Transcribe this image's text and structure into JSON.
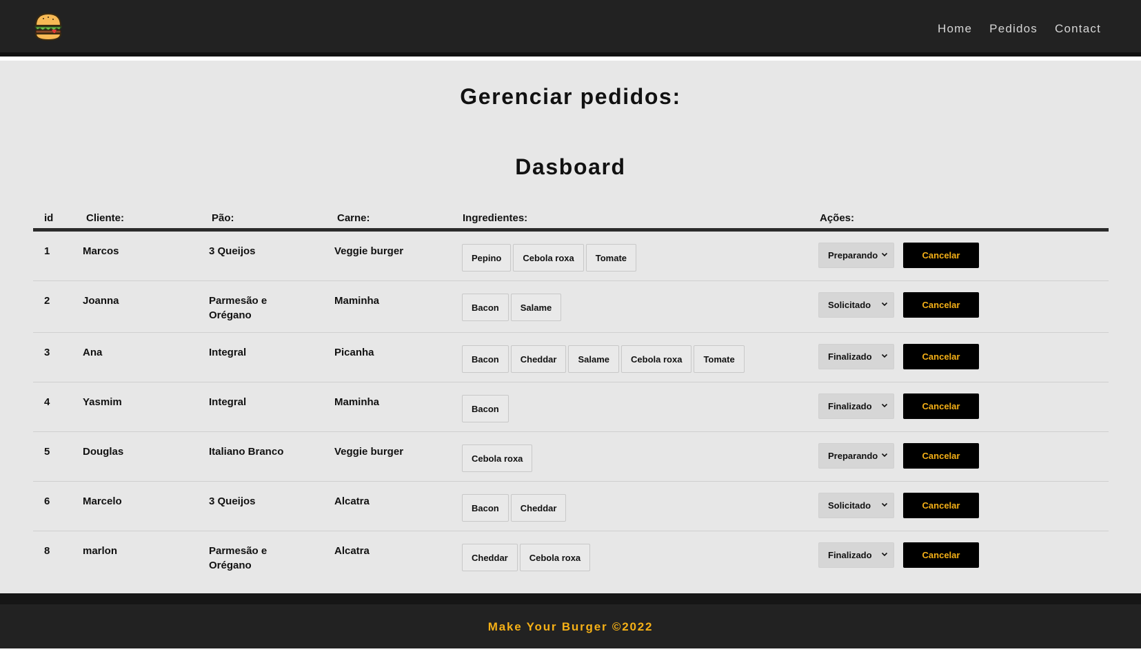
{
  "nav": {
    "logo_icon": "burger-icon",
    "links": [
      "Home",
      "Pedidos",
      "Contact"
    ]
  },
  "page": {
    "title": "Gerenciar pedidos:",
    "dashboard_title": "Dasboard"
  },
  "table": {
    "headers": {
      "id": "id",
      "client": "Cliente:",
      "bread": "Pão:",
      "meat": "Carne:",
      "ingredients": "Ingredientes:",
      "actions": "Ações:"
    },
    "cancel_label": "Cancelar",
    "rows": [
      {
        "id": "1",
        "client": "Marcos",
        "bread": "3 Queijos",
        "meat": "Veggie burger",
        "ingredients": [
          "Pepino",
          "Cebola roxa",
          "Tomate"
        ],
        "status": "Preparando"
      },
      {
        "id": "2",
        "client": "Joanna",
        "bread": "Parmesão e Orégano",
        "meat": "Maminha",
        "ingredients": [
          "Bacon",
          "Salame"
        ],
        "status": "Solicitado"
      },
      {
        "id": "3",
        "client": "Ana",
        "bread": "Integral",
        "meat": "Picanha",
        "ingredients": [
          "Bacon",
          "Cheddar",
          "Salame",
          "Cebola roxa",
          "Tomate"
        ],
        "status": "Finalizado"
      },
      {
        "id": "4",
        "client": "Yasmim",
        "bread": "Integral",
        "meat": "Maminha",
        "ingredients": [
          "Bacon"
        ],
        "status": "Finalizado"
      },
      {
        "id": "5",
        "client": "Douglas",
        "bread": "Italiano Branco",
        "meat": "Veggie burger",
        "ingredients": [
          "Cebola roxa"
        ],
        "status": "Preparando"
      },
      {
        "id": "6",
        "client": "Marcelo",
        "bread": "3 Queijos",
        "meat": "Alcatra",
        "ingredients": [
          "Bacon",
          "Cheddar"
        ],
        "status": "Solicitado"
      },
      {
        "id": "8",
        "client": "marlon",
        "bread": "Parmesão e Orégano",
        "meat": "Alcatra",
        "ingredients": [
          "Cheddar",
          "Cebola roxa"
        ],
        "status": "Finalizado"
      }
    ]
  },
  "footer": {
    "text": "Make Your Burger ©2022"
  },
  "colors": {
    "navbar_bg": "#222222",
    "main_bg": "#e7e7e7",
    "accent": "#f5b016",
    "cancel_bg": "#000000"
  }
}
